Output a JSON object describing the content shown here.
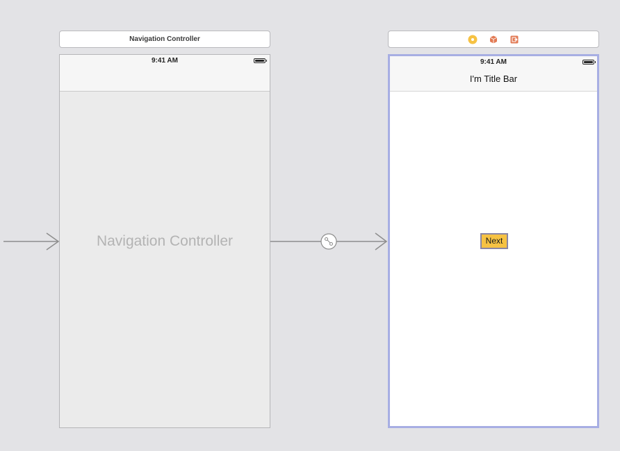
{
  "scenes": [
    {
      "bar_title": "Navigation Controller",
      "status_time": "9:41 AM",
      "placeholder_title": "Navigation Controller"
    },
    {
      "status_time": "9:41 AM",
      "nav_title": "I'm Title Bar",
      "button_label": "Next",
      "bar_icons": [
        "view-controller-icon",
        "first-responder-icon",
        "exit-icon"
      ]
    }
  ],
  "colors": {
    "canvas": "#e3e3e6",
    "selection_border": "#a7aee3",
    "button_fill": "#f6c243",
    "view_controller_icon": "#f6c243",
    "first_responder_icon": "#e27a54",
    "exit_icon": "#e27a54"
  }
}
